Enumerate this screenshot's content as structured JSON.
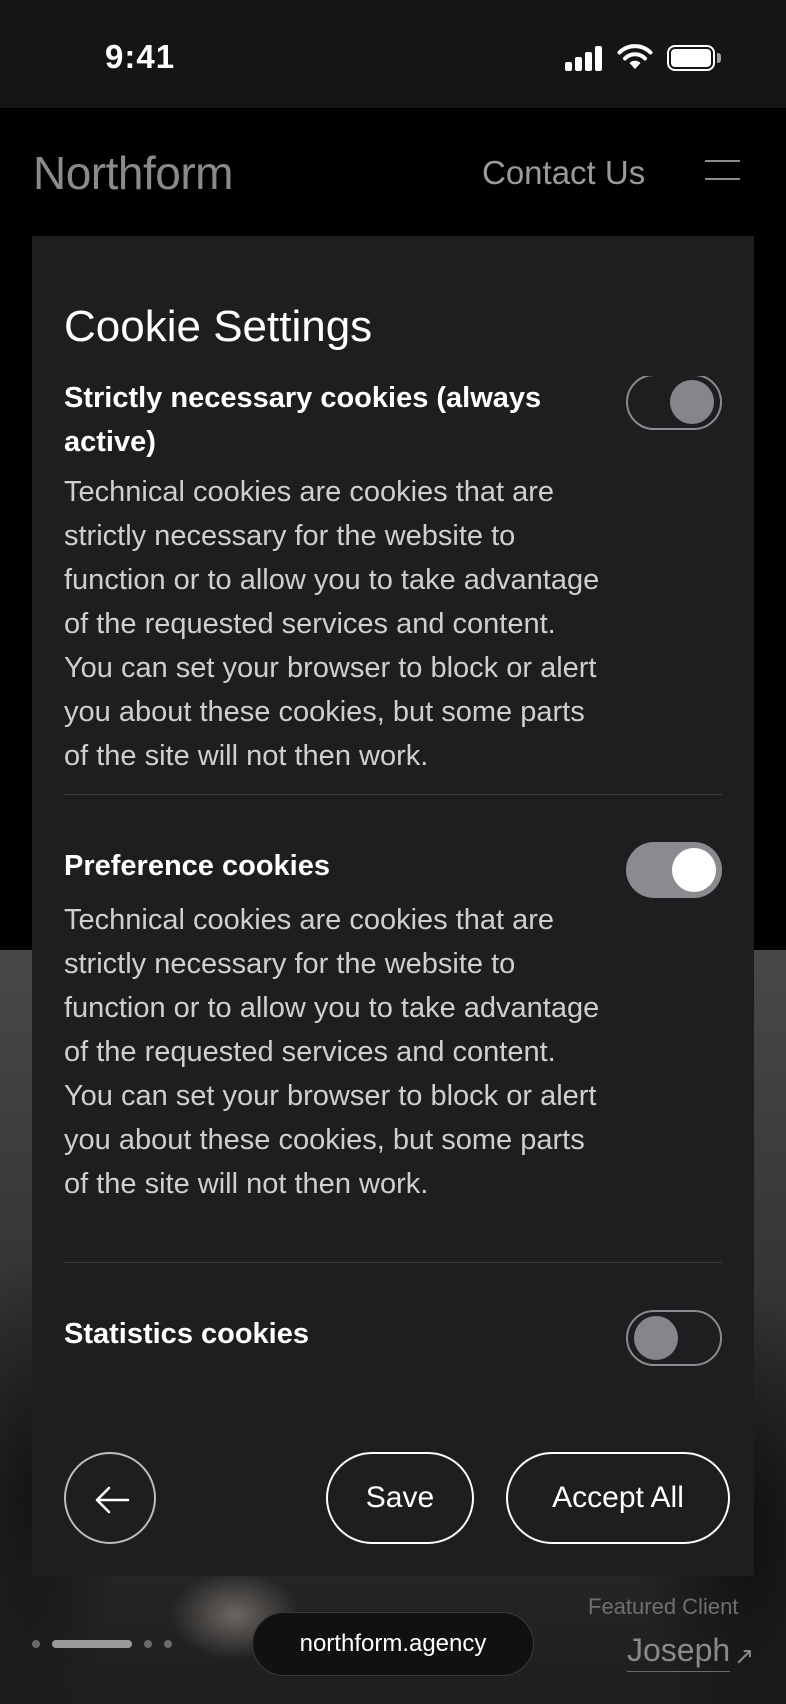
{
  "status_bar": {
    "time": "9:41"
  },
  "header": {
    "brand": "Northform",
    "contact": "Contact Us",
    "menu_icon": "hamburger-icon"
  },
  "modal": {
    "title": "Cookie Settings",
    "sections": [
      {
        "title": "Strictly necessary cookies (always active)",
        "description": "Technical cookies are cookies that are strictly necessary for the website to function or to allow you to take advantage of the requested services and content. You can set your browser to block or alert you about these cookies, but some parts of the site will not then work.",
        "toggle_state": "on-disabled"
      },
      {
        "title": "Preference cookies",
        "description": "Technical cookies are cookies that are strictly necessary for the website to function or to allow you to take advantage of the requested services and content. You can set your browser to block or alert you about these cookies, but some parts of the site will not then work.",
        "toggle_state": "on"
      },
      {
        "title": "Statistics cookies",
        "toggle_state": "off"
      }
    ],
    "footer": {
      "back_icon": "arrow-left-icon",
      "save_label": "Save",
      "accept_label": "Accept All"
    }
  },
  "page_footer": {
    "url": "northform.agency",
    "featured_label": "Featured Client",
    "client_name": "Joseph",
    "client_arrow": "↗"
  },
  "colors": {
    "modal_bg": "#1d1e20",
    "toggle_on": "#8a8b8f",
    "page_bg": "#000000"
  }
}
